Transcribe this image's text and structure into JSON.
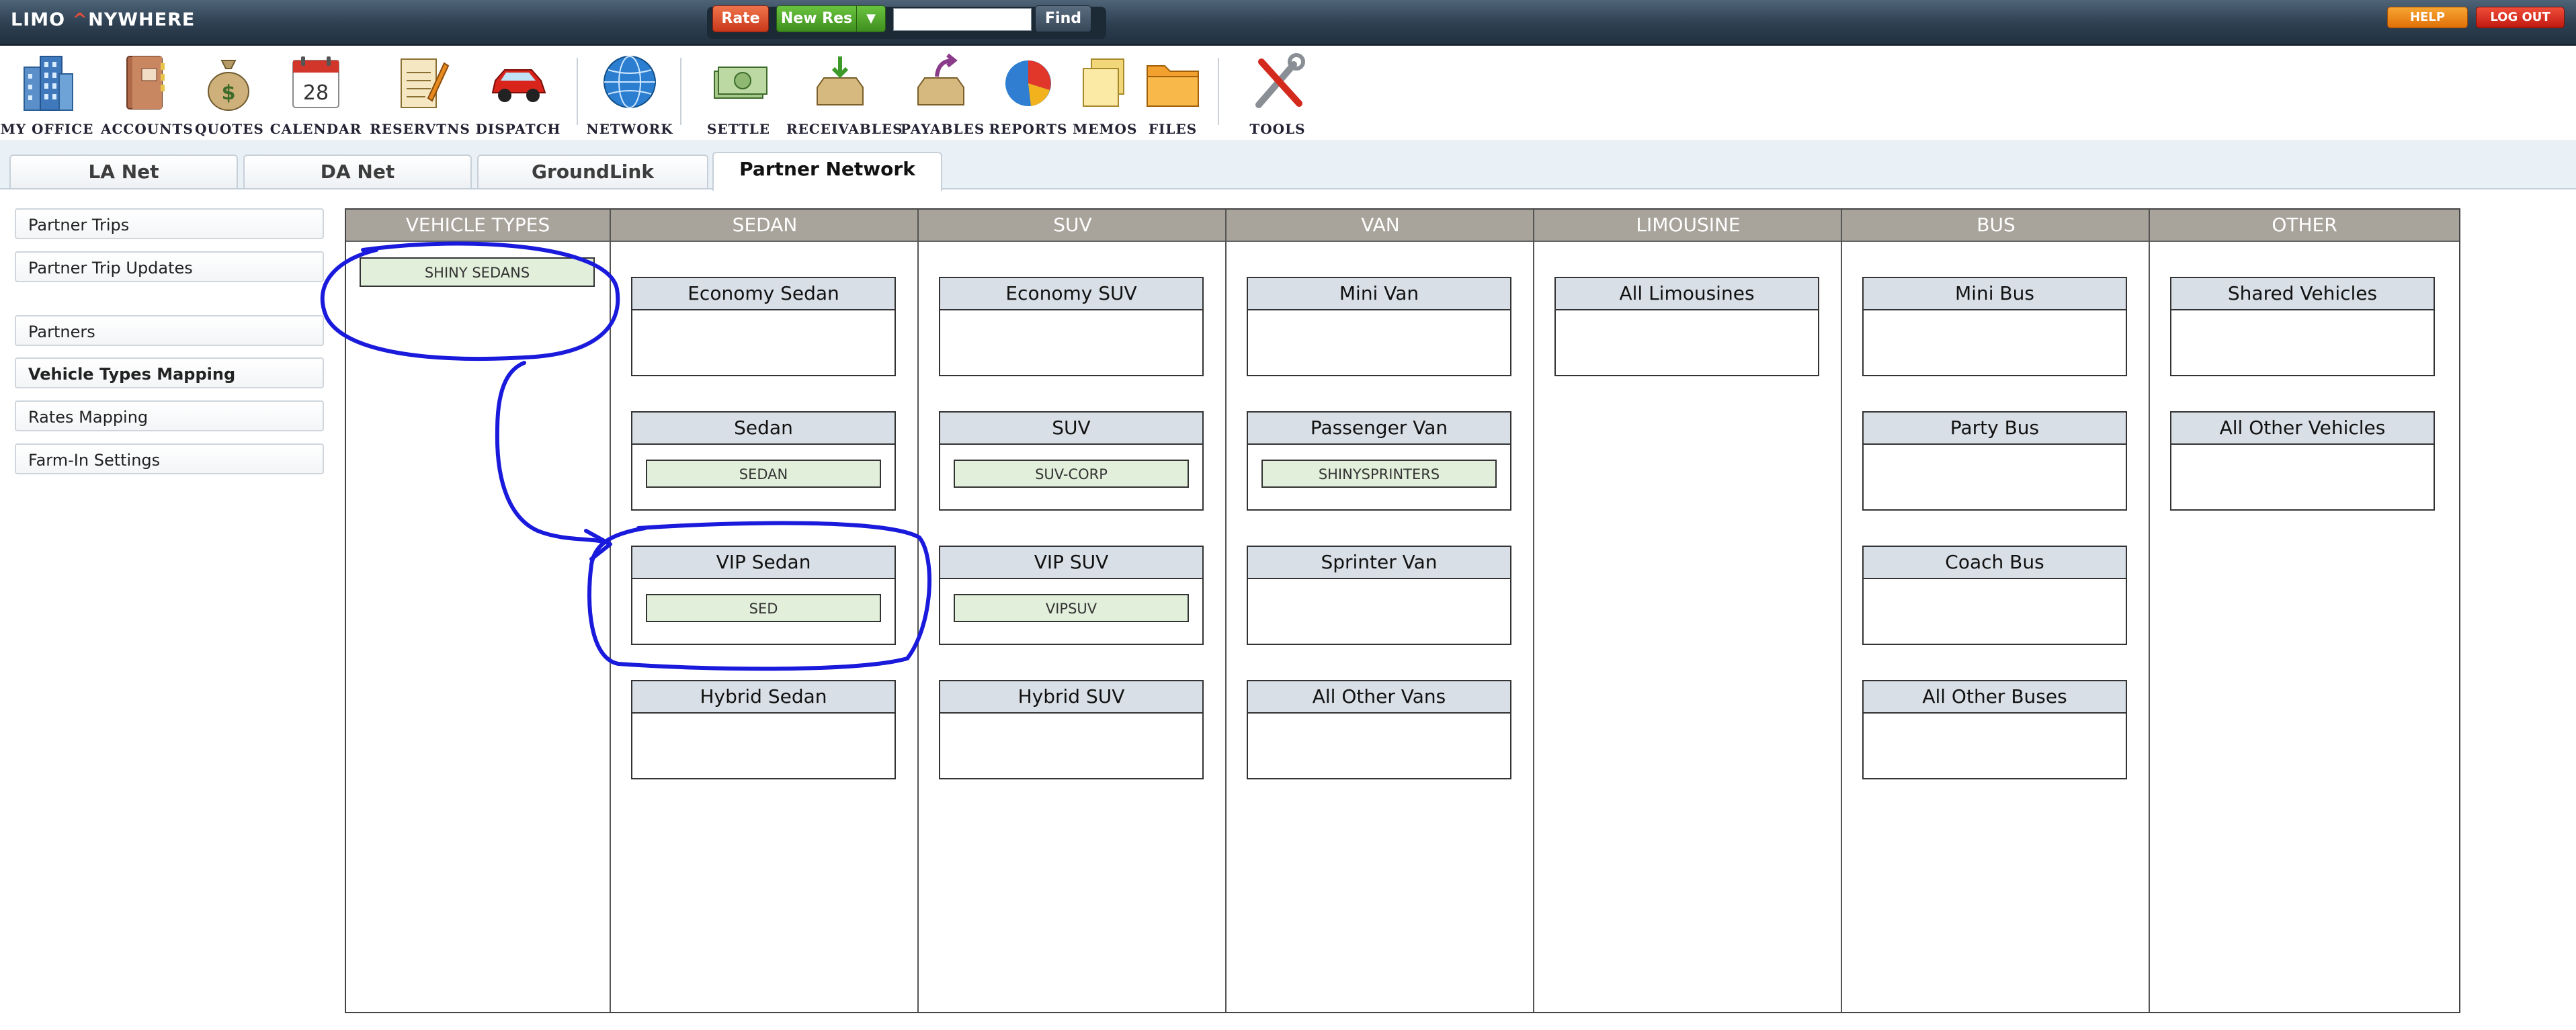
{
  "app": {
    "logo": {
      "part1": "LIMO ",
      "caret": "^",
      "part2": "NYWHERE"
    },
    "rate_label": "Rate",
    "newres_label": "New Res",
    "newres_dropdown": "▼",
    "find_label": "Find",
    "find_value": "",
    "help_label": "HELP",
    "logout_label": "LOG OUT"
  },
  "toolbar": [
    {
      "label": "MY OFFICE",
      "icon": "office-building-icon"
    },
    {
      "label": "ACCOUNTS",
      "icon": "address-book-icon"
    },
    {
      "label": "QUOTES",
      "icon": "money-bag-icon"
    },
    {
      "label": "CALENDAR",
      "icon": "calendar-icon",
      "day": "28"
    },
    {
      "label": "RESERVTNS",
      "icon": "notepad-icon"
    },
    {
      "label": "DISPATCH",
      "icon": "red-car-icon"
    },
    {
      "label": "NETWORK",
      "icon": "globe-icon"
    },
    {
      "label": "SETTLE",
      "icon": "cash-icon"
    },
    {
      "label": "RECEIVABLES",
      "icon": "inbox-tray-icon"
    },
    {
      "label": "PAYABLES",
      "icon": "outbox-tray-icon"
    },
    {
      "label": "REPORTS",
      "icon": "pie-chart-icon"
    },
    {
      "label": "MEMOS",
      "icon": "sticky-notes-icon"
    },
    {
      "label": "FILES",
      "icon": "folder-icon"
    },
    {
      "label": "TOOLS",
      "icon": "tools-icon"
    }
  ],
  "tabs": [
    {
      "label": "LA Net"
    },
    {
      "label": "DA Net"
    },
    {
      "label": "GroundLink"
    },
    {
      "label": "Partner Network",
      "active": true
    }
  ],
  "nav": [
    {
      "label": "Partner Trips"
    },
    {
      "label": "Partner Trip Updates"
    },
    {
      "label": "Partners"
    },
    {
      "label": "Vehicle Types Mapping",
      "active": true
    },
    {
      "label": "Rates Mapping"
    },
    {
      "label": "Farm-In Settings"
    }
  ],
  "vehicle_types": {
    "header": "VEHICLE TYPES",
    "items": [
      "SHINY SEDANS"
    ]
  },
  "columns": [
    {
      "header": "SEDAN",
      "slots": [
        {
          "title": "Economy Sedan",
          "chip": ""
        },
        {
          "title": "Sedan",
          "chip": "SEDAN"
        },
        {
          "title": "VIP Sedan",
          "chip": "SED"
        },
        {
          "title": "Hybrid Sedan",
          "chip": ""
        }
      ]
    },
    {
      "header": "SUV",
      "slots": [
        {
          "title": "Economy SUV",
          "chip": ""
        },
        {
          "title": "SUV",
          "chip": "SUV-CORP"
        },
        {
          "title": "VIP SUV",
          "chip": "VIPSUV"
        },
        {
          "title": "Hybrid SUV",
          "chip": ""
        }
      ]
    },
    {
      "header": "VAN",
      "slots": [
        {
          "title": "Mini Van",
          "chip": ""
        },
        {
          "title": "Passenger Van",
          "chip": "SHINYSPRINTERS"
        },
        {
          "title": "Sprinter Van",
          "chip": ""
        },
        {
          "title": "All Other Vans",
          "chip": ""
        }
      ]
    },
    {
      "header": "LIMOUSINE",
      "slots": [
        {
          "title": "All Limousines",
          "chip": ""
        }
      ]
    },
    {
      "header": "BUS",
      "slots": [
        {
          "title": "Mini Bus",
          "chip": ""
        },
        {
          "title": "Party Bus",
          "chip": ""
        },
        {
          "title": "Coach Bus",
          "chip": ""
        },
        {
          "title": "All Other Buses",
          "chip": ""
        }
      ]
    },
    {
      "header": "OTHER",
      "slots": [
        {
          "title": "Shared Vehicles",
          "chip": ""
        },
        {
          "title": "All Other Vehicles",
          "chip": ""
        }
      ]
    }
  ],
  "colors": {
    "column_header": "#a8a39b",
    "slot_header": "#d9dfe6",
    "chip_fill": "#e2efdb",
    "annotation_ink": "#1a1adc"
  }
}
